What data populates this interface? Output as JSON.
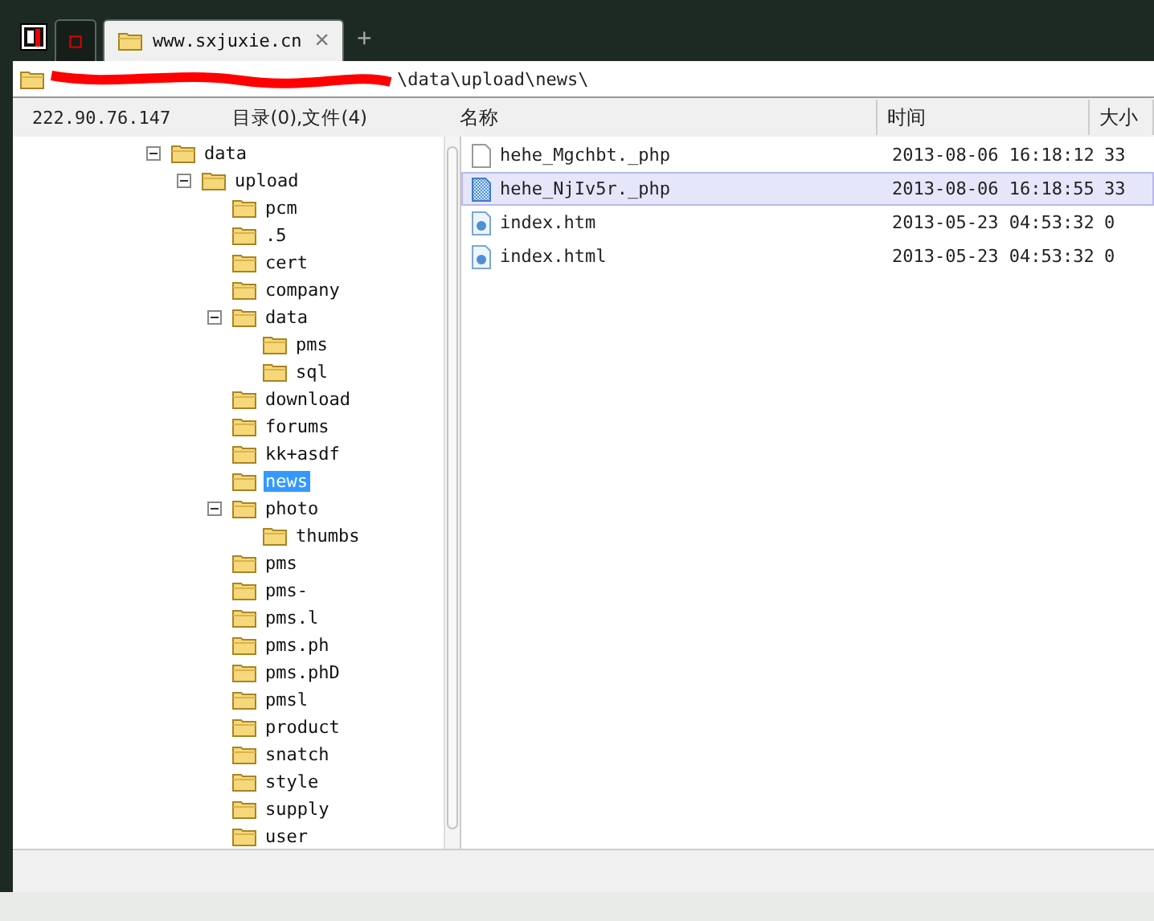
{
  "tab": {
    "title": "www.sxjuxie.cn",
    "close": "×",
    "new_tab": "+"
  },
  "address": {
    "path": "\\data\\upload\\news\\"
  },
  "left_header": {
    "host": "222.90.76.147",
    "summary": "目录(0),文件(4)"
  },
  "columns": [
    "名称",
    "时间",
    "大小"
  ],
  "tree": [
    {
      "name": "data",
      "selected": false,
      "expanded": true,
      "children": [
        {
          "name": "upload",
          "selected": false,
          "expanded": true,
          "children": [
            {
              "name": "pcm",
              "selected": false
            },
            {
              "name": ".5",
              "selected": false
            },
            {
              "name": "cert",
              "selected": false
            },
            {
              "name": "company",
              "selected": false
            },
            {
              "name": "data",
              "selected": false,
              "expanded": true,
              "children": [
                {
                  "name": "pms",
                  "selected": false
                },
                {
                  "name": "sql",
                  "selected": false
                }
              ]
            },
            {
              "name": "download",
              "selected": false
            },
            {
              "name": "forums",
              "selected": false
            },
            {
              "name": "kk+asdf",
              "selected": false
            },
            {
              "name": "news",
              "selected": true
            },
            {
              "name": "photo",
              "selected": false,
              "expanded": true,
              "children": [
                {
                  "name": "thumbs",
                  "selected": false
                }
              ]
            },
            {
              "name": "pms",
              "selected": false
            },
            {
              "name": "pms-",
              "selected": false
            },
            {
              "name": "pms.l",
              "selected": false
            },
            {
              "name": "pms.ph",
              "selected": false
            },
            {
              "name": "pms.phD",
              "selected": false
            },
            {
              "name": "pmsl",
              "selected": false
            },
            {
              "name": "product",
              "selected": false
            },
            {
              "name": "snatch",
              "selected": false
            },
            {
              "name": "style",
              "selected": false
            },
            {
              "name": "supply",
              "selected": false
            },
            {
              "name": "user",
              "selected": false
            }
          ]
        }
      ]
    }
  ],
  "files": [
    {
      "name": "hehe_Mgchbt._php",
      "time": "2013-08-06 16:18:12",
      "size": "33",
      "kind": "blank",
      "selected": false
    },
    {
      "name": "hehe_NjIv5r._php",
      "time": "2013-08-06 16:18:55",
      "size": "33",
      "kind": "checkered",
      "selected": true
    },
    {
      "name": "index.htm",
      "time": "2013-05-23 04:53:32",
      "size": "0",
      "kind": "web",
      "selected": false
    },
    {
      "name": "index.html",
      "time": "2013-05-23 04:53:32",
      "size": "0",
      "kind": "web",
      "selected": false
    }
  ]
}
